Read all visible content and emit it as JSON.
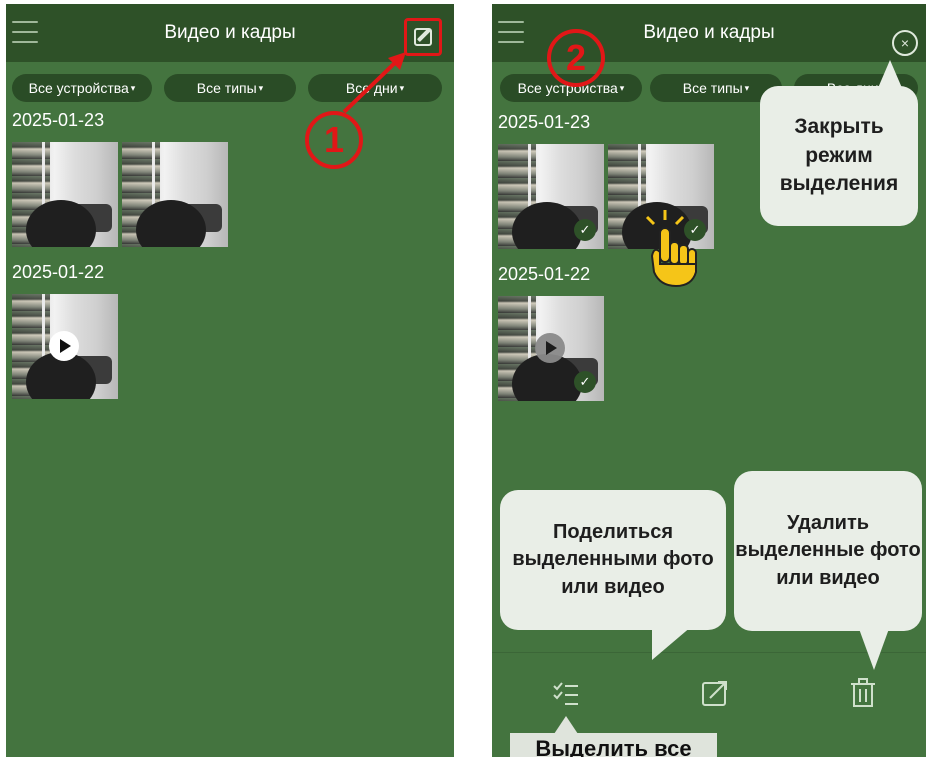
{
  "left_screen": {
    "title": "Видео и кадры",
    "menu_icon": "hamburger-icon",
    "edit_icon": "edit-icon",
    "filters": [
      {
        "label": "Все устройства",
        "caret": "▾"
      },
      {
        "label": "Все типы",
        "caret": "▾"
      },
      {
        "label": "Все дни",
        "caret": "▾"
      }
    ],
    "groups": [
      {
        "date": "2025-01-23",
        "items": [
          "photo",
          "photo"
        ]
      },
      {
        "date": "2025-01-22",
        "items": [
          "video"
        ]
      }
    ],
    "step_badge": "1"
  },
  "right_screen": {
    "title": "Видео и кадры",
    "menu_icon": "hamburger-icon",
    "close_icon": "close-circle-icon",
    "close_glyph": "×",
    "filters": [
      {
        "label": "Все устройства",
        "caret": "▾"
      },
      {
        "label": "Все типы",
        "caret": "▾"
      },
      {
        "label": "Все дни",
        "caret": "▾"
      }
    ],
    "groups": [
      {
        "date": "2025-01-23",
        "items": [
          "photo-selected",
          "photo-selected"
        ]
      },
      {
        "date": "2025-01-22",
        "items": [
          "video-selected"
        ]
      }
    ],
    "check_glyph": "✓",
    "step_badge": "2",
    "bottom_bar": {
      "select_all_icon": "checklist-icon",
      "share_icon": "share-icon",
      "delete_icon": "trash-icon"
    },
    "callouts": {
      "close_mode": "Закрыть режим выделения",
      "share": "Поделиться выделенными фото или видео",
      "delete": "Удалить выделенные фото или видео",
      "select_all": "Выделить все"
    }
  },
  "colors": {
    "app_background": "#44743f",
    "header_background": "#2e5128",
    "pill_background": "#2a4c26",
    "annotation_red": "#e11717",
    "callout_background": "#e9eee7",
    "hand_yellow": "#f5c518"
  }
}
